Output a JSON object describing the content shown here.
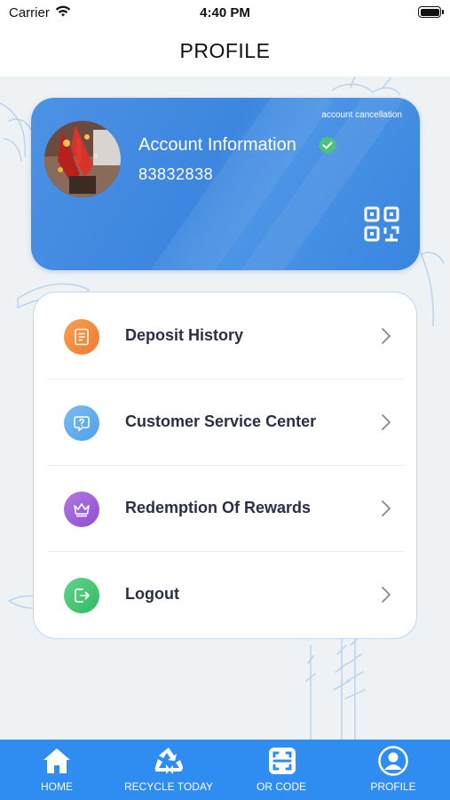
{
  "status_bar": {
    "carrier": "Carrier",
    "time": "4:40 PM"
  },
  "header": {
    "title": "PROFILE"
  },
  "account": {
    "cancel_label": "account cancellation",
    "title": "Account Information",
    "number": "83832838",
    "verified": true
  },
  "menu": {
    "items": [
      {
        "label": "Deposit History",
        "icon": "document-icon",
        "color": "#f08a3a"
      },
      {
        "label": "Customer Service Center",
        "icon": "support-chat-icon",
        "color": "#5aa8ee"
      },
      {
        "label": "Redemption Of Rewards",
        "icon": "crown-icon",
        "color": "#9b59d6"
      },
      {
        "label": "Logout",
        "icon": "logout-icon",
        "color": "#3fc36b"
      }
    ]
  },
  "tabs": [
    {
      "label": "HOME",
      "icon": "home-icon"
    },
    {
      "label": "RECYCLE TODAY",
      "icon": "recycle-icon"
    },
    {
      "label": "OR CODE",
      "icon": "scan-code-icon"
    },
    {
      "label": "PROFILE",
      "icon": "profile-icon"
    }
  ],
  "colors": {
    "accent": "#2f8cf1",
    "card": "#4089e1",
    "verified": "#4cc27a"
  }
}
